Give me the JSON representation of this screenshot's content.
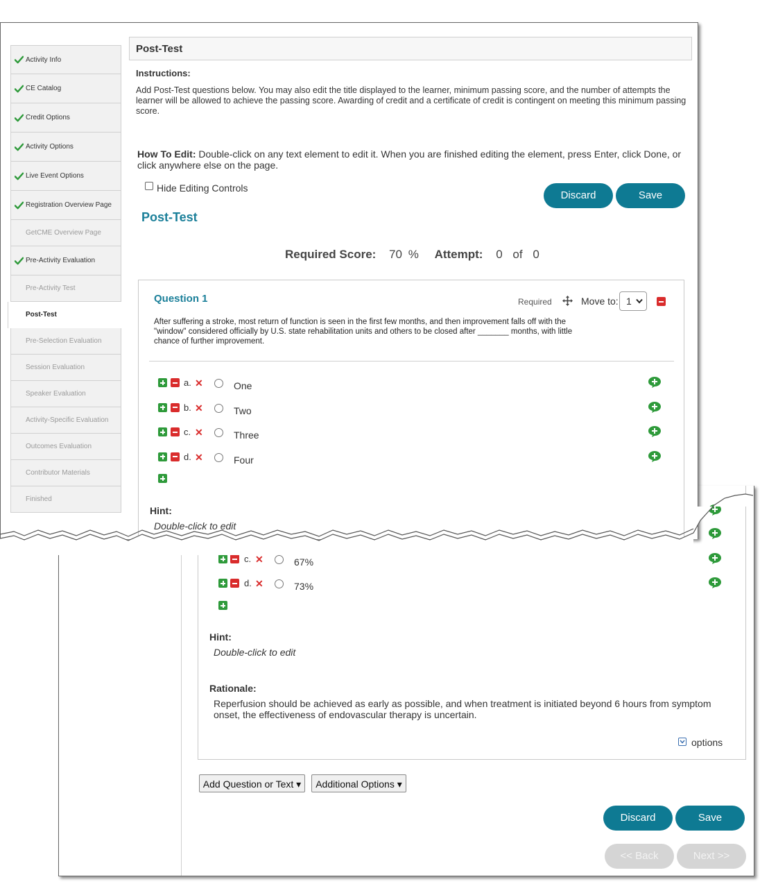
{
  "sidebar": {
    "items": [
      {
        "label": "Activity Info",
        "checked": true,
        "state": "done"
      },
      {
        "label": "CE Catalog",
        "checked": true,
        "state": "done"
      },
      {
        "label": "Credit Options",
        "checked": true,
        "state": "done"
      },
      {
        "label": "Activity Options",
        "checked": true,
        "state": "done"
      },
      {
        "label": "Live Event Options",
        "checked": true,
        "state": "done"
      },
      {
        "label": "Registration Overview Page",
        "checked": true,
        "state": "done"
      },
      {
        "label": "GetCME Overview Page",
        "checked": false,
        "state": "disabled"
      },
      {
        "label": "Pre-Activity Evaluation",
        "checked": true,
        "state": "done"
      },
      {
        "label": "Pre-Activity Test",
        "checked": false,
        "state": "disabled"
      },
      {
        "label": "Post-Test",
        "checked": false,
        "state": "active"
      },
      {
        "label": "Pre-Selection Evaluation",
        "checked": false,
        "state": "disabled"
      },
      {
        "label": "Session Evaluation",
        "checked": false,
        "state": "disabled"
      },
      {
        "label": "Speaker Evaluation",
        "checked": false,
        "state": "disabled"
      },
      {
        "label": "Activity-Specific Evaluation",
        "checked": false,
        "state": "disabled"
      },
      {
        "label": "Outcomes Evaluation",
        "checked": false,
        "state": "disabled"
      },
      {
        "label": "Contributor Materials",
        "checked": false,
        "state": "disabled"
      },
      {
        "label": "Finished",
        "checked": false,
        "state": "disabled"
      }
    ]
  },
  "header": {
    "title": "Post-Test"
  },
  "instructions": {
    "label": "Instructions:",
    "text": "Add Post-Test questions below. You may also edit the title displayed to the learner, minimum passing score, and the number of attempts the learner will be allowed to achieve the passing score. Awarding of credit and a certificate of credit is contingent on meeting this minimum passing score."
  },
  "how_to_edit": {
    "label": "How To Edit:",
    "text": " Double-click on any text element to edit it. When you are finished editing the element, press Enter, click Done, or click anywhere else on the page."
  },
  "hide_controls_label": "Hide Editing Controls",
  "buttons": {
    "discard": "Discard",
    "save": "Save",
    "back": "<< Back",
    "next": "Next >>",
    "add_question": "Add Question or Text",
    "additional_options": "Additional Options"
  },
  "test_title": "Post-Test",
  "score": {
    "required_label": "Required Score:",
    "required_value": "70",
    "percent": "%",
    "attempt_label": "Attempt:",
    "attempt_value": "0",
    "of": "of",
    "attempt_total": "0"
  },
  "question1": {
    "title": "Question 1",
    "required": "Required",
    "move_to_label": "Move to:",
    "move_to_value": "1",
    "text": "After suffering a stroke, most return of function is seen in the first few months, and then improvement falls off with the \"window\" considered officially by U.S. state rehabilitation units and others to be closed after _______ months, with little chance of further improvement.",
    "options": [
      {
        "letter": "a.",
        "text": "One"
      },
      {
        "letter": "b.",
        "text": "Two"
      },
      {
        "letter": "c.",
        "text": "Three"
      },
      {
        "letter": "d.",
        "text": "Four"
      }
    ],
    "hint_label": "Hint:",
    "hint_text": "Double-click to edit"
  },
  "question2": {
    "options": [
      {
        "letter": "c.",
        "text": "67%"
      },
      {
        "letter": "d.",
        "text": "73%"
      }
    ],
    "hint_label": "Hint:",
    "hint_text": "Double-click to edit",
    "rationale_label": "Rationale:",
    "rationale_text": "Reperfusion should be achieved as early as possible, and when treatment is initiated beyond 6 hours from symptom onset, the effectiveness of endovascular therapy is uncertain.",
    "options_link": "options"
  },
  "colors": {
    "accent": "#0e7a93",
    "plus": "#2e9a3a",
    "minus": "#d92c2c",
    "link_teal": "#1a7f99"
  }
}
